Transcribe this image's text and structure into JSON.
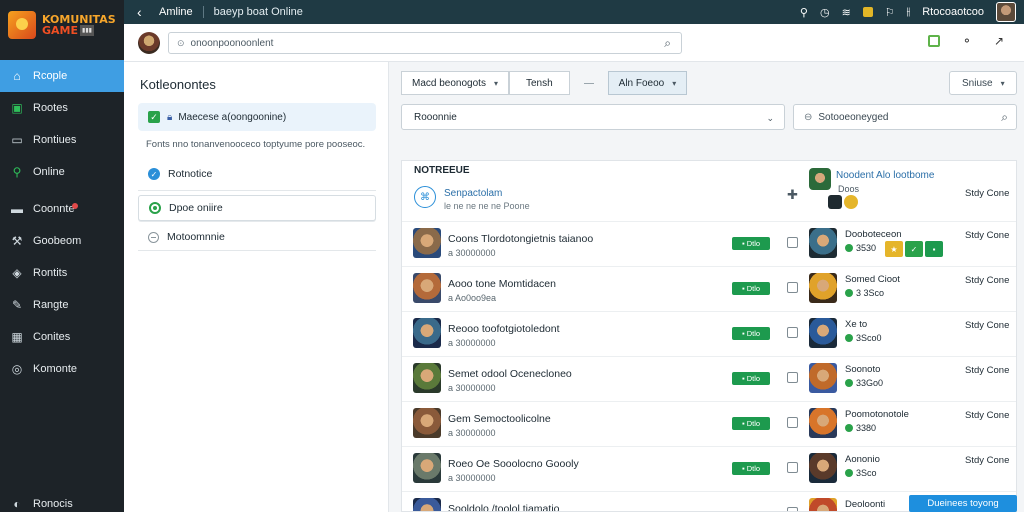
{
  "brand": {
    "line1": "KOMUNITAS",
    "line2": "GAME",
    "tag": "▮▮▮"
  },
  "topbar": {
    "back_icon": "chevron-left-icon",
    "title": "Amline",
    "subtitle": "baeyp boat Online",
    "user_name": "Rtocoaotcoo"
  },
  "sidebar": {
    "items": [
      {
        "label": "Rcople",
        "icon": "home-icon",
        "active": true
      },
      {
        "label": "Rootes",
        "icon": "chat-icon",
        "active": false
      },
      {
        "label": "Rontiues",
        "icon": "monitor-icon",
        "active": false
      },
      {
        "label": "Online",
        "icon": "location-icon",
        "active": false
      },
      {
        "label": "Coonnte",
        "icon": "window-icon",
        "active": false,
        "badge": true
      },
      {
        "label": "Goobeom",
        "icon": "wrench-icon",
        "active": false
      },
      {
        "label": "Rontits",
        "icon": "shield-icon",
        "active": false
      },
      {
        "label": "Rangte",
        "icon": "pencil-icon",
        "active": false
      },
      {
        "label": "Conites",
        "icon": "grid-icon",
        "active": false
      },
      {
        "label": "Komonte",
        "icon": "settings-icon",
        "active": false
      }
    ],
    "bottom_label": "Ronocis"
  },
  "header": {
    "search_placeholder": "onoonpoonoonlent",
    "search_prefix": "⊙"
  },
  "left_panel": {
    "title": "Kotleonontes",
    "selected_label": "Maecese a(oongoonine)",
    "description": "Fonts nno tonanvenooceco toptyume pore pooseoc.",
    "options": [
      {
        "label": "Rotnotice",
        "state": "checked"
      },
      {
        "label": "Dpoe oniire",
        "state": "green"
      },
      {
        "label": "Motoomnnie",
        "state": "off"
      }
    ]
  },
  "filters": {
    "tabs": [
      "Macd beonogots",
      "Tensh",
      "Aln Foeoo"
    ],
    "sort_label": "Sniuse",
    "dropdown_label": "Rooonnie",
    "search2_placeholder": "Sotooeoneyged"
  },
  "list": {
    "title": "NOTREEUE",
    "header": {
      "name": "Senpactolam",
      "sub": "le ne ne ne ne Poone",
      "status": "Stdy Cone"
    },
    "featured": {
      "name": "Noodent Alo lootbome",
      "sub": "Doos"
    },
    "rows": [
      {
        "name": "Coons Tlordotongietnis taianoo",
        "sub": "a 30000000",
        "btn": "▪ Dtlo",
        "name2": "Dooboteceon",
        "sub2": "3530",
        "status": "Stdy Cone",
        "av": [
          "#8a6a4a",
          "#2a4a7a"
        ],
        "av2": [
          "#3b6f8a",
          "#1d2b33"
        ],
        "badges": true
      },
      {
        "name": "Aooo tone Momtidacen",
        "sub": "a Ao0oo9ea",
        "btn": "▪ Dtlo",
        "name2": "Somed Cioot",
        "sub2": "3 3Sco",
        "status": "Stdy Cone",
        "av": [
          "#b46a3a",
          "#3a4a6a"
        ],
        "av2": [
          "#e0a22a",
          "#3a2a1a"
        ],
        "badges": false
      },
      {
        "name": "Reooo toofotgiotoledont",
        "sub": "a 30000000",
        "btn": "▪ Dtlo",
        "name2": "Xe to",
        "sub2": "3Sco0",
        "status": "Stdy Cone",
        "av": [
          "#3a6a8a",
          "#1a2a4a"
        ],
        "av2": [
          "#2a5a9a",
          "#1a2a3a"
        ],
        "badges": false
      },
      {
        "name": "Semet odool Ocenecloneo",
        "sub": "a 30000000",
        "btn": "▪ Dtlo",
        "name2": "Soonoto",
        "sub2": "33Go0",
        "status": "Stdy Cone",
        "av": [
          "#5a7a3a",
          "#2a3a2a"
        ],
        "av2": [
          "#c06a2a",
          "#3a5aa0"
        ],
        "badges": false
      },
      {
        "name": "Gem Semoctoolicolne",
        "sub": "a 30000000",
        "btn": "▪ Dtlo",
        "name2": "Poomotonotole",
        "sub2": "3380",
        "status": "Stdy Cone",
        "av": [
          "#8a5a3a",
          "#4a3a2a"
        ],
        "av2": [
          "#d8752a",
          "#2a3a5a"
        ],
        "badges": false
      },
      {
        "name": "Roeo Oe Sooolocno Goooly",
        "sub": "a 30000000",
        "btn": "▪ Dtlo",
        "name2": "Aononio",
        "sub2": "3Sco",
        "status": "Stdy Cone",
        "av": [
          "#6a7a6a",
          "#2a3a3a"
        ],
        "av2": [
          "#5a3a2a",
          "#1a2a3a"
        ],
        "badges": false
      },
      {
        "name": "Sooldolo /toolol tiamatio",
        "sub": "",
        "btn": "",
        "name2": "Deoloonti",
        "sub2": "",
        "status": "",
        "av": [
          "#3a5a9a",
          "#1a2a4a"
        ],
        "av2": [
          "#c04a2a",
          "#e0a22a"
        ],
        "badges": false
      }
    ]
  },
  "cta_label": "Dueinees toyong",
  "colors": {
    "accent": "#3f9ee3",
    "sidebar": "#1d2328",
    "topbar": "#1f3a44",
    "success": "#1d9a4e"
  }
}
